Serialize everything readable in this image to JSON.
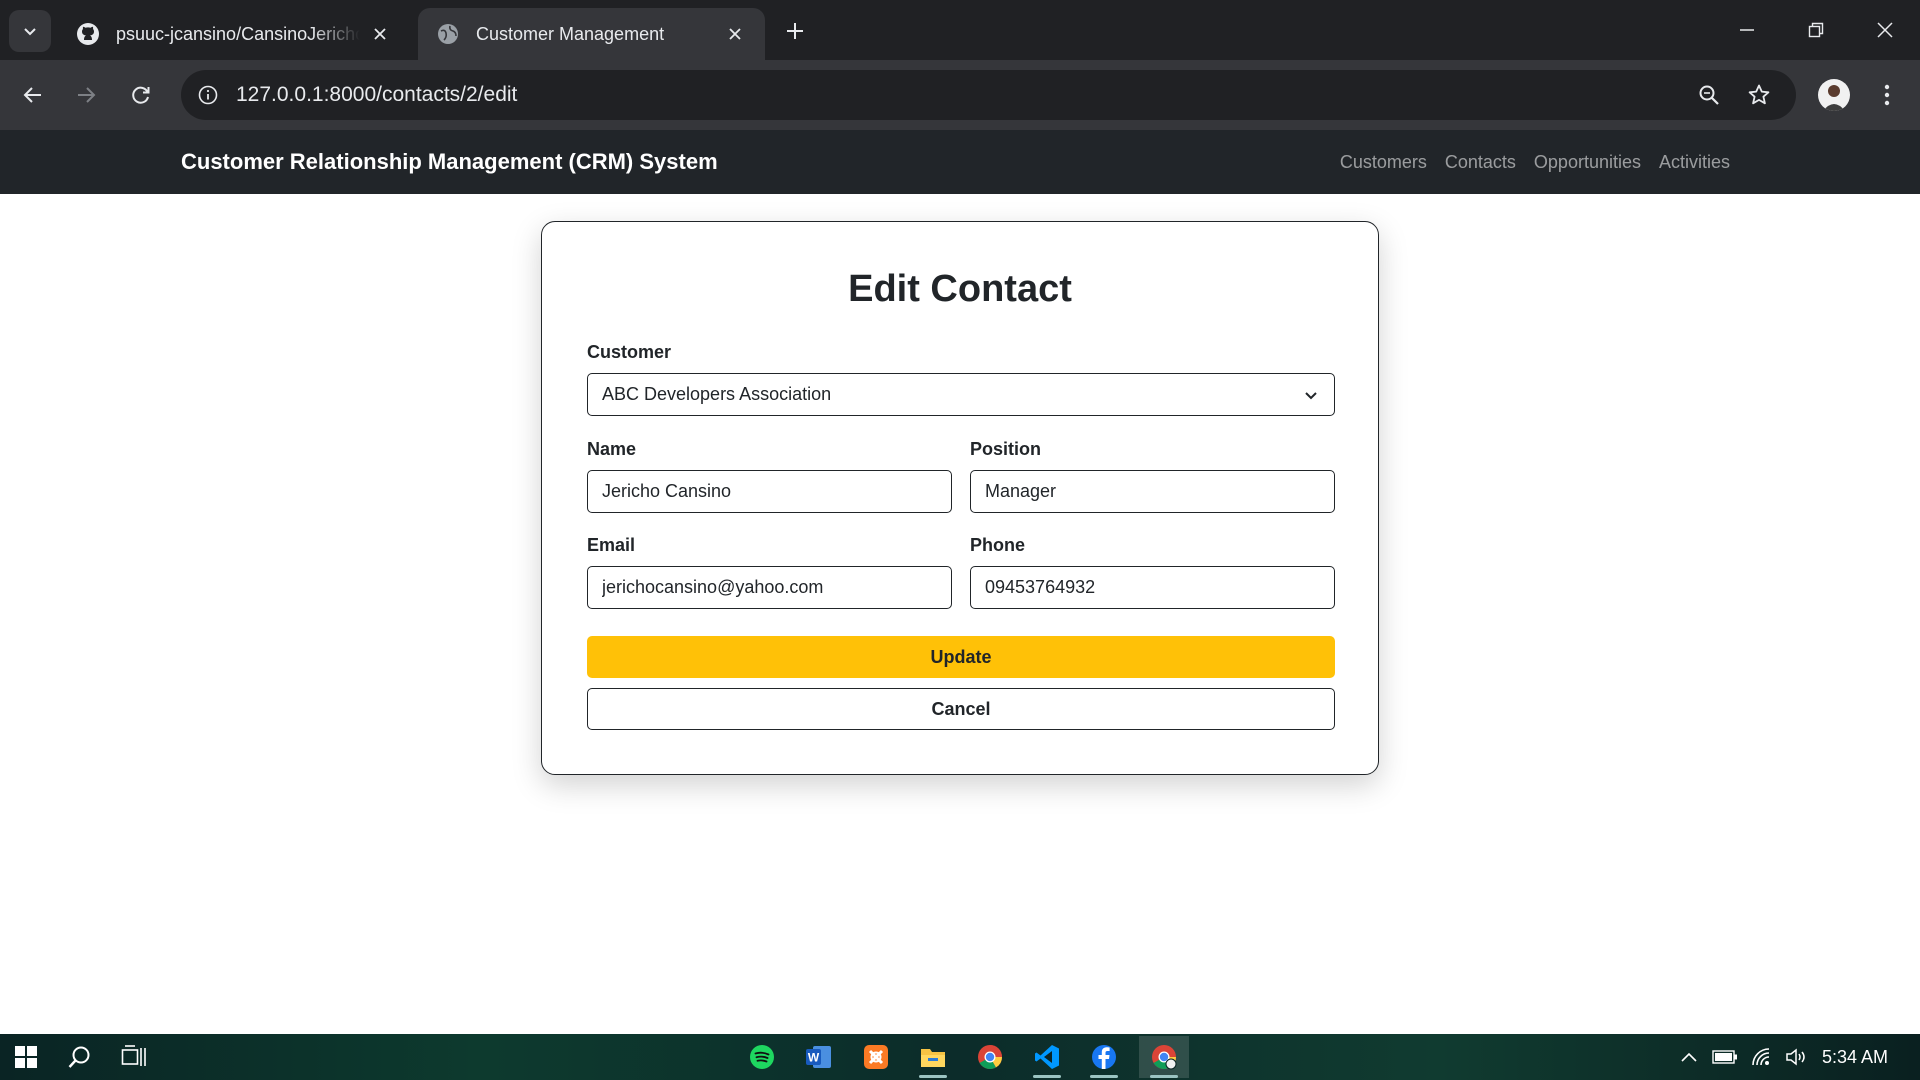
{
  "browser": {
    "tabs": [
      {
        "title": "psuuc-jcansino/CansinoJericho",
        "favicon": "github-icon",
        "active": false
      },
      {
        "title": "Customer Management",
        "favicon": "globe-icon",
        "active": true
      }
    ],
    "url": "127.0.0.1:8000/contacts/2/edit"
  },
  "app": {
    "brand": "Customer Relationship Management (CRM) System",
    "nav": [
      "Customers",
      "Contacts",
      "Opportunities",
      "Activities"
    ]
  },
  "form": {
    "title": "Edit Contact",
    "customer_label": "Customer",
    "customer_value": "ABC Developers Association",
    "name_label": "Name",
    "name_value": "Jericho Cansino",
    "position_label": "Position",
    "position_value": "Manager",
    "email_label": "Email",
    "email_value": "jerichocansino@yahoo.com",
    "phone_label": "Phone",
    "phone_value": "09453764932",
    "update_label": "Update",
    "cancel_label": "Cancel",
    "update_color": "#ffc107"
  },
  "taskbar": {
    "apps": [
      "spotify-icon",
      "word-icon",
      "xampp-icon",
      "file-explorer-icon",
      "chrome-icon",
      "vscode-icon",
      "facebook-icon",
      "chrome-profile-icon"
    ],
    "time": "5:34 AM"
  }
}
